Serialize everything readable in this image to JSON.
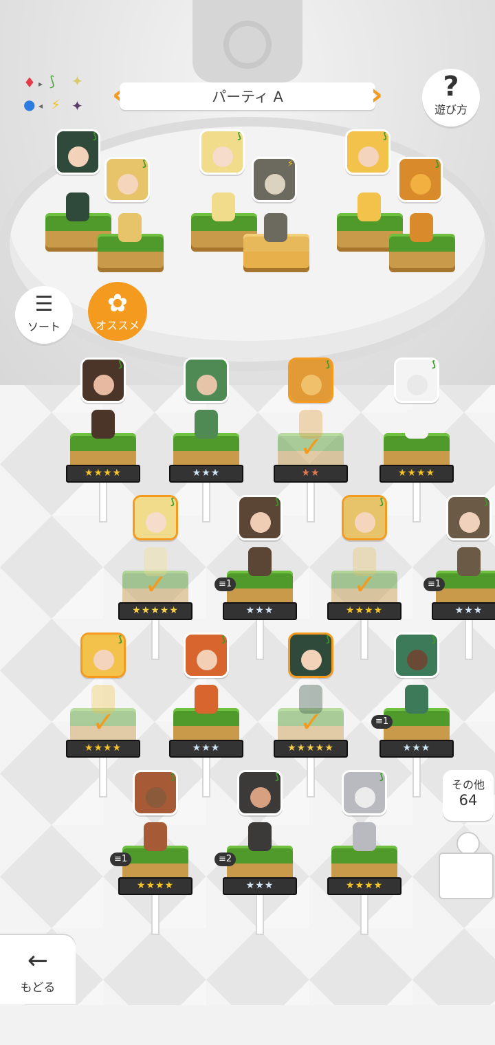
{
  "header": {
    "party_name": "パーティ A",
    "prev_icon": "chevron-left",
    "next_icon": "chevron-right"
  },
  "help": {
    "icon": "question-mark",
    "label": "遊び方"
  },
  "sort": {
    "icon": "sort-icon",
    "label": "ソート"
  },
  "recommend": {
    "icon": "flower-icon",
    "label": "オススメ"
  },
  "element_chart": {
    "row1": [
      "♦",
      "▸",
      "⟆",
      "✦"
    ],
    "row2": [
      "●",
      "◂",
      "⚡",
      "✦"
    ]
  },
  "party_slots": [
    {
      "portrait_color": "#2f4a3a",
      "face": "#f2d2b8",
      "element": "leaf"
    },
    {
      "portrait_color": "#e7c46a",
      "face": "#f5d6bd",
      "element": "leaf"
    },
    {
      "portrait_color": "#f0dc8a",
      "face": "#f6dccb",
      "element": "leaf"
    },
    {
      "portrait_color": "#6c6a5f",
      "face": "#d9d3c0",
      "element": "lightning"
    },
    {
      "portrait_color": "#f2c24a",
      "face": "#f5d4be",
      "element": "leaf"
    },
    {
      "portrait_color": "#d98a2a",
      "face": "#f1b040",
      "element": "leaf"
    }
  ],
  "roster": [
    {
      "stars": "★★★★",
      "rank": "gold",
      "selected": false,
      "level": "",
      "portrait": "#4a3528",
      "face": "#e7b9a0"
    },
    {
      "stars": "★★★",
      "rank": "blue",
      "selected": false,
      "level": "",
      "portrait": "#4f8a55",
      "face": "#e5c4a8"
    },
    {
      "stars": "★★",
      "rank": "bronze",
      "selected": true,
      "level": "",
      "portrait": "#e19a35",
      "face": "#f0c06a"
    },
    {
      "stars": "★★★★",
      "rank": "gold",
      "selected": false,
      "level": "",
      "portrait": "#f4f4f4",
      "face": "#e9e9e9"
    },
    {
      "stars": "★★★★★",
      "rank": "rainbow",
      "selected": true,
      "level": "",
      "portrait": "#f0dc8a",
      "face": "#f6dccb"
    },
    {
      "stars": "★★★",
      "rank": "blue",
      "selected": false,
      "level": "1",
      "portrait": "#5b4636",
      "face": "#efcdb4"
    },
    {
      "stars": "★★★★",
      "rank": "gold",
      "selected": true,
      "level": "",
      "portrait": "#e7c46a",
      "face": "#f5d6bd"
    },
    {
      "stars": "★★★",
      "rank": "blue",
      "selected": false,
      "level": "1",
      "portrait": "#6b5a45",
      "face": "#f0d2bc"
    },
    {
      "stars": "★★★★",
      "rank": "gold",
      "selected": true,
      "level": "",
      "portrait": "#f2c24a",
      "face": "#f5d4be"
    },
    {
      "stars": "★★★",
      "rank": "blue",
      "selected": false,
      "level": "",
      "portrait": "#d8642e",
      "face": "#f3cfb5"
    },
    {
      "stars": "★★★★★",
      "rank": "rainbow",
      "selected": true,
      "level": "",
      "portrait": "#2f4a3a",
      "face": "#f2d2b8"
    },
    {
      "stars": "★★★",
      "rank": "blue",
      "selected": false,
      "level": "1",
      "portrait": "#3d7a5a",
      "face": "#6a4a35"
    },
    {
      "stars": "★★★★",
      "rank": "gold",
      "selected": false,
      "level": "1",
      "portrait": "#a65a35",
      "face": "#8a5a3a"
    },
    {
      "stars": "★★★",
      "rank": "blue",
      "selected": false,
      "level": "2",
      "portrait": "#3c3a38",
      "face": "#d7a080"
    },
    {
      "stars": "★★★★",
      "rank": "gold",
      "selected": false,
      "level": "",
      "portrait": "#b9b9c0",
      "face": "#ececec"
    }
  ],
  "others": {
    "label": "その他",
    "count": "64"
  },
  "back": {
    "icon": "arrow-left",
    "label": "もどる"
  }
}
